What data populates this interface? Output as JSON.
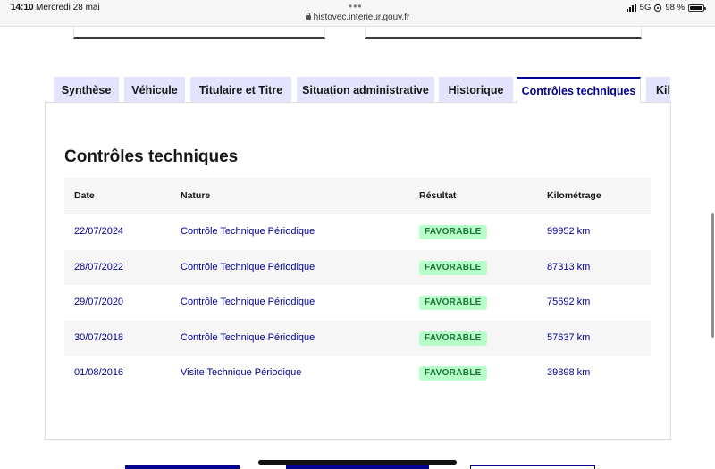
{
  "status_bar": {
    "time": "14:10",
    "date": "Mercredi 28 mai",
    "url": "histovec.interieur.gouv.fr",
    "network": "5G",
    "battery": "98 %",
    "battery_level": 0.98
  },
  "tabs": [
    {
      "label": "Synthèse",
      "active": false
    },
    {
      "label": "Véhicule",
      "active": false
    },
    {
      "label": "Titulaire et Titre",
      "active": false
    },
    {
      "label": "Situation administrative",
      "active": false
    },
    {
      "label": "Historique",
      "active": false
    },
    {
      "label": "Contrôles techniques",
      "active": true
    },
    {
      "label": "Kilo",
      "active": false
    }
  ],
  "section": {
    "title": "Contrôles techniques"
  },
  "table": {
    "headers": {
      "date": "Date",
      "nature": "Nature",
      "result": "Résultat",
      "km": "Kilométrage"
    },
    "rows": [
      {
        "date": "22/07/2024",
        "nature": "Contrôle Technique Périodique",
        "result": "FAVORABLE",
        "km": "99952 km"
      },
      {
        "date": "28/07/2022",
        "nature": "Contrôle Technique Périodique",
        "result": "FAVORABLE",
        "km": "87313 km"
      },
      {
        "date": "29/07/2020",
        "nature": "Contrôle Technique Périodique",
        "result": "FAVORABLE",
        "km": "75692 km"
      },
      {
        "date": "30/07/2018",
        "nature": "Contrôle Technique Périodique",
        "result": "FAVORABLE",
        "km": "57637 km"
      },
      {
        "date": "01/08/2016",
        "nature": "Visite Technique Périodique",
        "result": "FAVORABLE",
        "km": "39898 km"
      }
    ]
  },
  "colors": {
    "accent": "#000091",
    "tab_bg": "#e3e3fd",
    "success_bg": "#b8fec9",
    "success_text": "#18753c"
  }
}
